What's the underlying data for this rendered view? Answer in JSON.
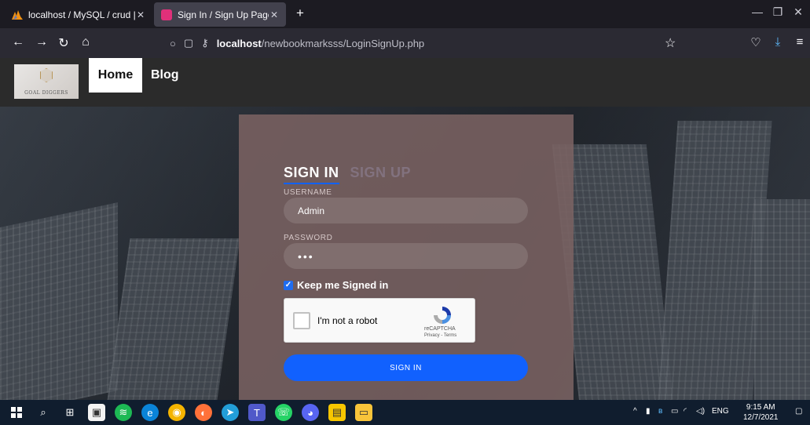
{
  "browser": {
    "tabs": [
      {
        "title": "localhost / MySQL / crud | phpM",
        "active": false
      },
      {
        "title": "Sign In / Sign Up Page",
        "active": true
      }
    ],
    "url_host": "localhost",
    "url_path": "/newbookmarksss/LoginSignUp.php"
  },
  "site": {
    "logo_text": "GOAL DIGGERS",
    "menu": [
      "Home",
      "Blog"
    ]
  },
  "login": {
    "tab_signin": "SIGN IN",
    "tab_signup": "SIGN UP",
    "username_label": "USERNAME",
    "username_value": "Admin",
    "password_label": "PASSWORD",
    "password_value": "•••",
    "keep_signed_in": "Keep me Signed in",
    "captcha_text": "I'm not a robot",
    "captcha_brand": "reCAPTCHA",
    "captcha_links": "Privacy - Terms",
    "submit_label": "SIGN IN"
  },
  "taskbar": {
    "lang": "ENG",
    "time": "9:15 AM",
    "date": "12/7/2021"
  },
  "colors": {
    "accent": "#1161fe",
    "card": "#7a6262"
  }
}
